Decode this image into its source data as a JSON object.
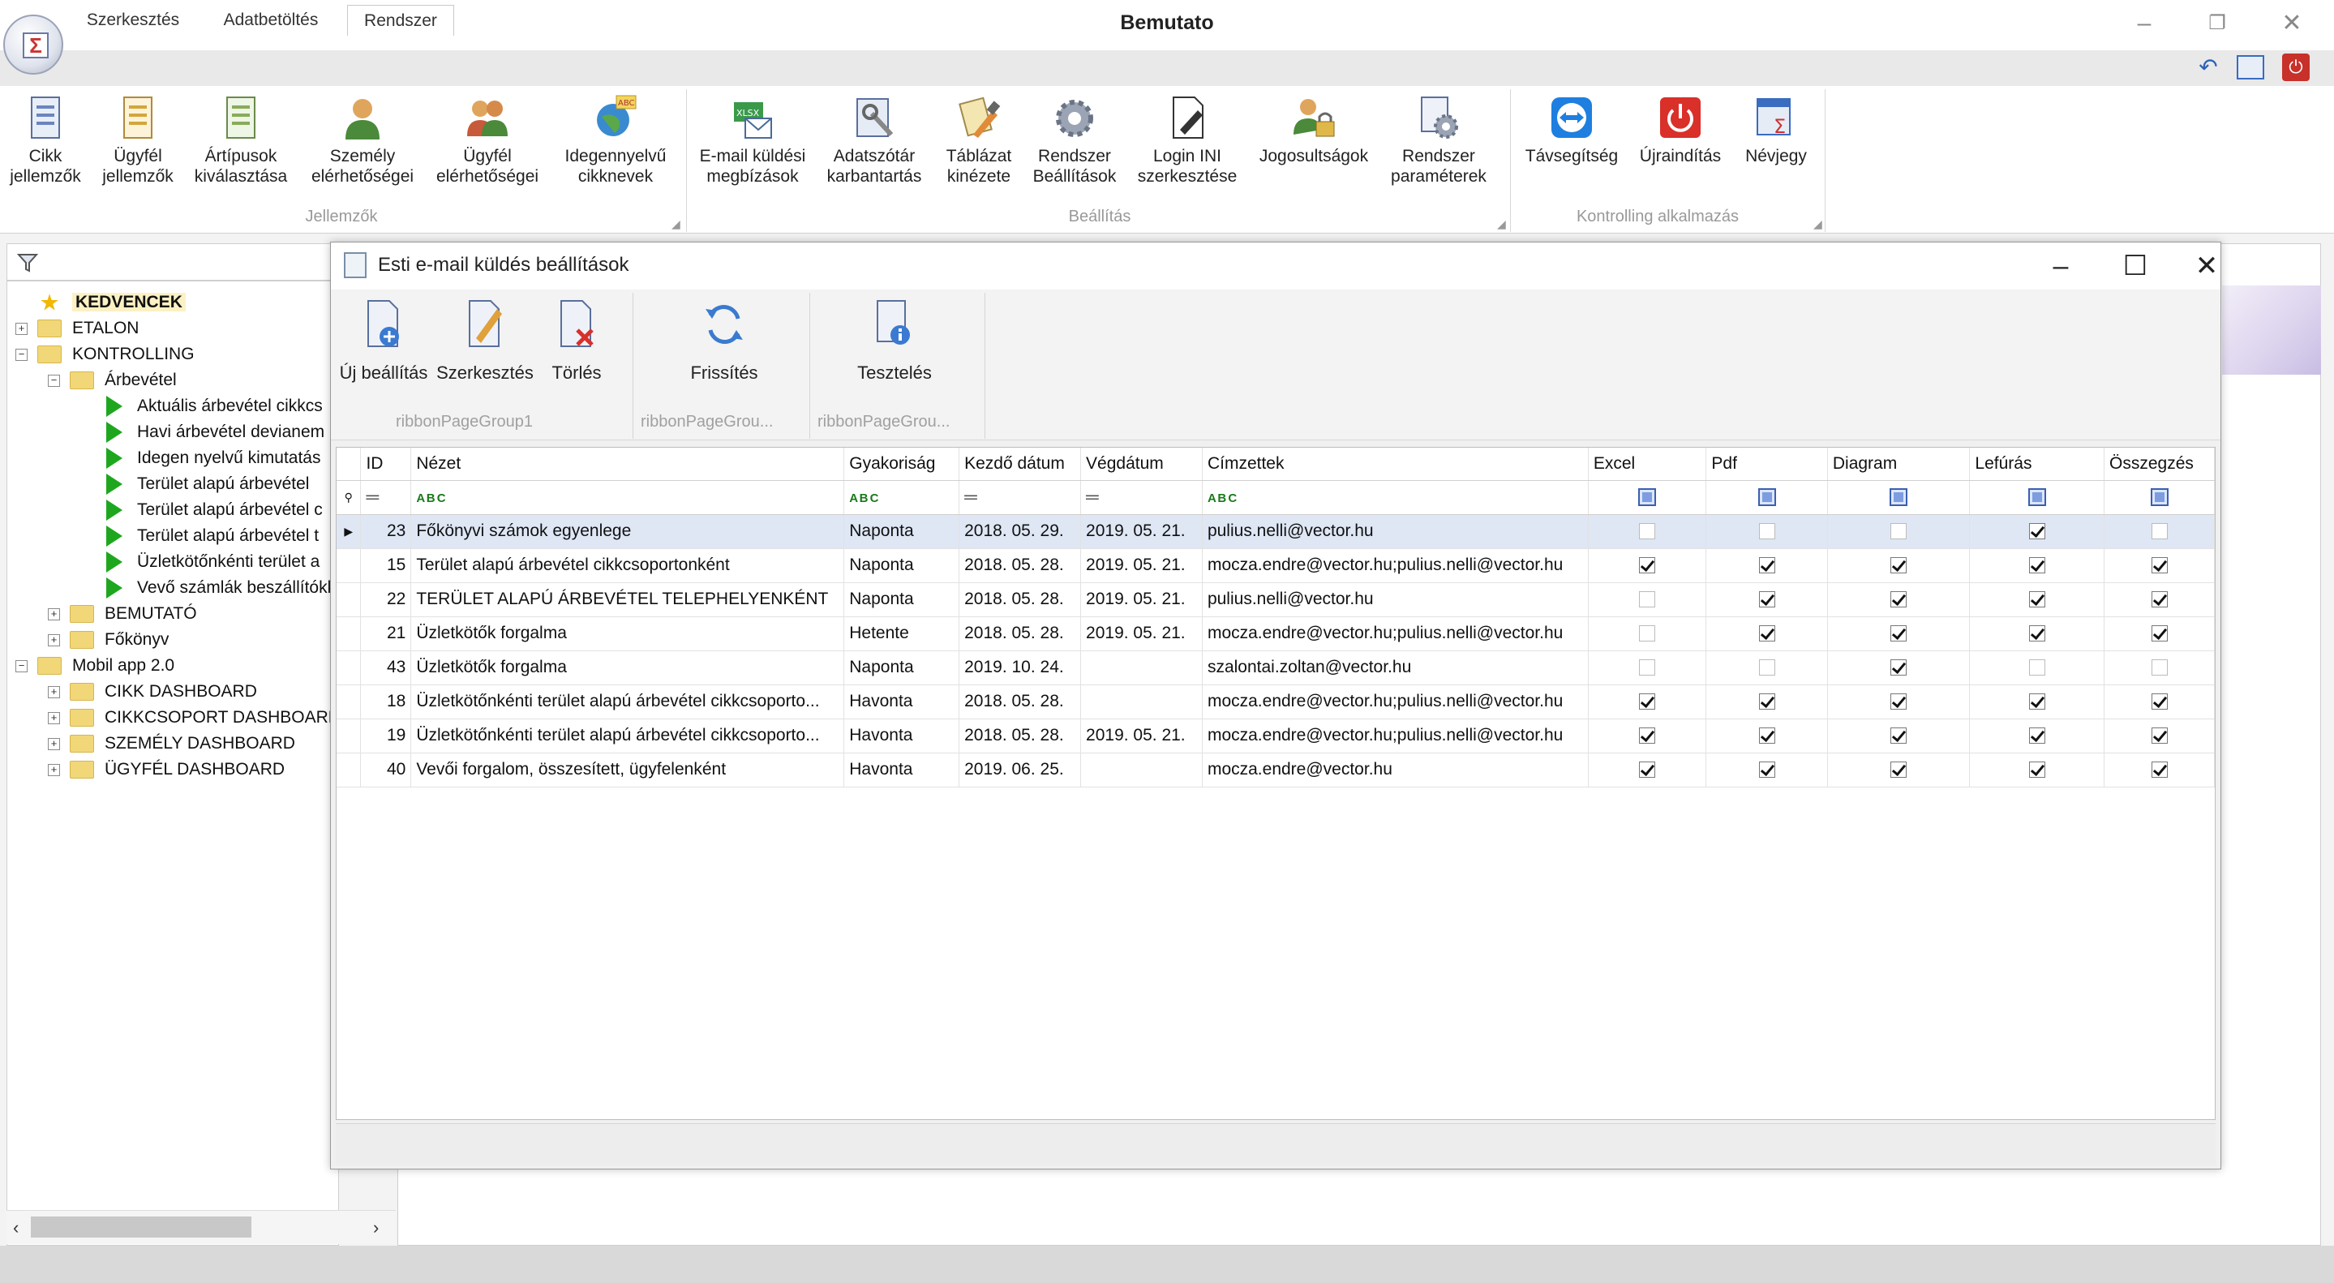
{
  "window": {
    "title": "Bemutato"
  },
  "tabs": [
    "Szerkesztés",
    "Adatbetöltés",
    "Rendszer"
  ],
  "ribbon": {
    "jellemzok": {
      "label": "Jellemzők",
      "items": [
        [
          "Cikk",
          "jellemzők"
        ],
        [
          "Ügyfél",
          "jellemzők"
        ],
        [
          "Ártípusok",
          "kiválasztása"
        ],
        [
          "Személy",
          "elérhetőségei"
        ],
        [
          "Ügyfél",
          "elérhetőségei"
        ],
        [
          "Idegennyelvű",
          "cikknevek"
        ]
      ]
    },
    "beallitas": {
      "label": "Beállítás",
      "items": [
        [
          "E-mail küldési",
          "megbízások"
        ],
        [
          "Adatszótár",
          "karbantartás"
        ],
        [
          "Táblázat",
          "kinézete"
        ],
        [
          "Rendszer",
          "Beállítások"
        ],
        [
          "Login INI",
          "szerkesztése"
        ],
        [
          "Jogosultságok",
          ""
        ],
        [
          "Rendszer",
          "paraméterek"
        ]
      ]
    },
    "kontrolling": {
      "label": "Kontrolling alkalmazás",
      "items": [
        [
          "Távsegítség",
          ""
        ],
        [
          "Újraindítás",
          ""
        ],
        [
          "Névjegy",
          ""
        ]
      ]
    }
  },
  "tree": [
    {
      "label": "KEDVENCEK",
      "level": 0,
      "type": "star",
      "exp": ""
    },
    {
      "label": "ETALON",
      "level": 0,
      "type": "folder",
      "exp": "+"
    },
    {
      "label": "KONTROLLING",
      "level": 0,
      "type": "folder",
      "exp": "−"
    },
    {
      "label": "Árbevétel",
      "level": 1,
      "type": "folder",
      "exp": "−"
    },
    {
      "label": "Aktuális árbevétel cikkcs",
      "level": 2,
      "type": "report",
      "exp": ""
    },
    {
      "label": "Havi árbevétel devianem",
      "level": 2,
      "type": "report",
      "exp": ""
    },
    {
      "label": "Idegen nyelvű kimutatás",
      "level": 2,
      "type": "report",
      "exp": ""
    },
    {
      "label": "Terület alapú árbevétel",
      "level": 2,
      "type": "report",
      "exp": ""
    },
    {
      "label": "Terület alapú árbevétel c",
      "level": 2,
      "type": "report",
      "exp": ""
    },
    {
      "label": "Terület alapú árbevétel t",
      "level": 2,
      "type": "report",
      "exp": ""
    },
    {
      "label": "Üzletkötőnkénti terület a",
      "level": 2,
      "type": "report",
      "exp": ""
    },
    {
      "label": "Vevő számlák beszállítókk",
      "level": 2,
      "type": "report",
      "exp": ""
    },
    {
      "label": "BEMUTATÓ",
      "level": 1,
      "type": "folder",
      "exp": "+"
    },
    {
      "label": "Főkönyv",
      "level": 1,
      "type": "folder",
      "exp": "+"
    },
    {
      "label": "Mobil app 2.0",
      "level": 0,
      "type": "folder",
      "exp": "−"
    },
    {
      "label": "CIKK DASHBOARD",
      "level": 1,
      "type": "folder",
      "exp": "+"
    },
    {
      "label": "CIKKCSOPORT DASHBOARD",
      "level": 1,
      "type": "folder",
      "exp": "+"
    },
    {
      "label": "SZEMÉLY DASHBOARD",
      "level": 1,
      "type": "folder",
      "exp": "+"
    },
    {
      "label": "ÜGYFÉL DASHBOARD",
      "level": 1,
      "type": "folder",
      "exp": "+"
    }
  ],
  "dialog": {
    "title": "Esti e-mail küldés beállítások",
    "buttons": {
      "new": "Új beállítás",
      "edit": "Szerkesztés",
      "delete": "Törlés",
      "refresh": "Frissítés",
      "test": "Tesztelés"
    },
    "groups": [
      "ribbonPageGroup1",
      "ribbonPageGrou...",
      "ribbonPageGrou..."
    ],
    "columns": [
      "ID",
      "Nézet",
      "Gyakoriság",
      "Kezdő dátum",
      "Végdátum",
      "Címzettek",
      "Excel",
      "Pdf",
      "Diagram",
      "Lefúrás",
      "Összegzés"
    ],
    "rows": [
      {
        "id": "23",
        "view": "Főkönyvi számok egyenlege",
        "freq": "Naponta",
        "start": "2018. 05. 29.",
        "end": "2019. 05. 21.",
        "to": "pulius.nelli@vector.hu",
        "flags": [
          false,
          false,
          false,
          true,
          false
        ],
        "selected": true
      },
      {
        "id": "15",
        "view": "Terület alapú árbevétel cikkcsoportonként",
        "freq": "Naponta",
        "start": "2018. 05. 28.",
        "end": "2019. 05. 21.",
        "to": "mocza.endre@vector.hu;pulius.nelli@vector.hu",
        "flags": [
          true,
          true,
          true,
          true,
          true
        ]
      },
      {
        "id": "22",
        "view": "TERÜLET ALAPÚ ÁRBEVÉTEL TELEPHELYENKÉNT",
        "freq": "Naponta",
        "start": "2018. 05. 28.",
        "end": "2019. 05. 21.",
        "to": "pulius.nelli@vector.hu",
        "flags": [
          false,
          true,
          true,
          true,
          true
        ]
      },
      {
        "id": "21",
        "view": "Üzletkötők forgalma",
        "freq": "Hetente",
        "start": "2018. 05. 28.",
        "end": "2019. 05. 21.",
        "to": "mocza.endre@vector.hu;pulius.nelli@vector.hu",
        "flags": [
          false,
          true,
          true,
          true,
          true
        ]
      },
      {
        "id": "43",
        "view": "Üzletkötők forgalma",
        "freq": "Naponta",
        "start": "2019. 10. 24.",
        "end": "",
        "to": "szalontai.zoltan@vector.hu",
        "flags": [
          false,
          false,
          true,
          false,
          false
        ]
      },
      {
        "id": "18",
        "view": "Üzletkötőnkénti terület alapú árbevétel cikkcsoporto...",
        "freq": "Havonta",
        "start": "2018. 05. 28.",
        "end": "",
        "to": "mocza.endre@vector.hu;pulius.nelli@vector.hu",
        "flags": [
          true,
          true,
          true,
          true,
          true
        ]
      },
      {
        "id": "19",
        "view": "Üzletkötőnkénti terület alapú árbevétel cikkcsoporto...",
        "freq": "Havonta",
        "start": "2018. 05. 28.",
        "end": "2019. 05. 21.",
        "to": "mocza.endre@vector.hu;pulius.nelli@vector.hu",
        "flags": [
          true,
          true,
          true,
          true,
          true
        ]
      },
      {
        "id": "40",
        "view": "Vevői forgalom, összesített, ügyfelenként",
        "freq": "Havonta",
        "start": "2019. 06. 25.",
        "end": "",
        "to": "mocza.endre@vector.hu",
        "flags": [
          true,
          true,
          true,
          true,
          true
        ]
      }
    ]
  },
  "icons": {
    "filter": "funnel-icon",
    "star": "star-icon",
    "folder": "folder-icon",
    "report": "play-arrow-icon"
  },
  "colors": {
    "selected_row": "#dfe7f5",
    "report_arrow": "#1ea71e",
    "folder": "#f2d779",
    "power": "#d9302a",
    "teamviewer": "#1e7fe0"
  }
}
